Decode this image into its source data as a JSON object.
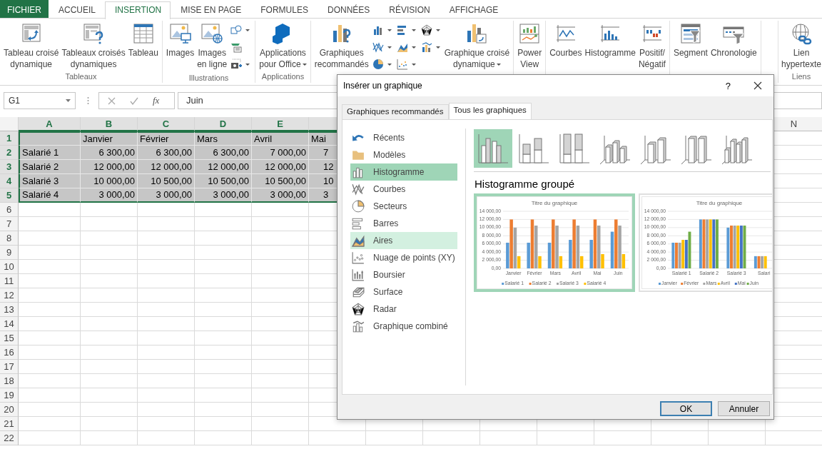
{
  "ribbon": {
    "tabs": [
      {
        "label": "FICHIER",
        "kind": "file",
        "selected": false
      },
      {
        "label": "ACCUEIL",
        "kind": "tab",
        "selected": false
      },
      {
        "label": "INSERTION",
        "kind": "tab",
        "selected": true
      },
      {
        "label": "MISE EN PAGE",
        "kind": "tab",
        "selected": false
      },
      {
        "label": "FORMULES",
        "kind": "tab",
        "selected": false
      },
      {
        "label": "DONNÉES",
        "kind": "tab",
        "selected": false
      },
      {
        "label": "RÉVISION",
        "kind": "tab",
        "selected": false
      },
      {
        "label": "AFFICHAGE",
        "kind": "tab",
        "selected": false
      }
    ],
    "groups": [
      {
        "label": "Tableaux",
        "items": [
          {
            "kind": "pivot-table",
            "label": "Tableau croisé\ndynamique"
          },
          {
            "kind": "recommended-pivot",
            "label": "Tableaux croisés\ndynamiques"
          },
          {
            "kind": "table",
            "label": "Tableau"
          }
        ]
      },
      {
        "label": "Illustrations",
        "items": [
          {
            "kind": "images",
            "label": "Images"
          },
          {
            "kind": "online-images",
            "label": "Images\nen ligne"
          },
          {
            "kind": "stack",
            "buttons": [
              {
                "kind": "shapes",
                "has_menu": true
              },
              {
                "kind": "smartart",
                "has_menu": false
              },
              {
                "kind": "screenshot",
                "has_menu": true
              }
            ]
          }
        ]
      },
      {
        "label": "Applications",
        "items": [
          {
            "kind": "apps",
            "label": "Applications\npour Office",
            "has_menu": true
          }
        ]
      },
      {
        "items": [
          {
            "kind": "recommended-charts",
            "label": "Graphiques\nrecommandés"
          },
          {
            "kind": "stack",
            "buttons": [
              {
                "kind": "column",
                "has_menu": true
              },
              {
                "kind": "line",
                "has_menu": true
              },
              {
                "kind": "pie",
                "has_menu": true
              },
              {
                "kind": "bar",
                "has_menu": true
              },
              {
                "kind": "area",
                "has_menu": true
              },
              {
                "kind": "scatter",
                "has_menu": true
              },
              {
                "kind": "radar",
                "has_menu": true
              },
              {
                "kind": "combo",
                "has_menu": true
              }
            ]
          },
          {
            "kind": "pivot-chart",
            "label": "Graphique croisé\ndynamique",
            "has_menu": true
          }
        ]
      },
      {
        "items": [
          {
            "kind": "power-view",
            "label": "Power\nView"
          }
        ]
      },
      {
        "items": [
          {
            "kind": "line-spark",
            "label": "Courbes"
          },
          {
            "kind": "column-spark",
            "label": "Histogramme"
          },
          {
            "kind": "winloss",
            "label": "Positif/\nNégatif"
          }
        ]
      },
      {
        "items": [
          {
            "kind": "slicer",
            "label": "Segment"
          },
          {
            "kind": "timeline",
            "label": "Chronologie"
          }
        ]
      },
      {
        "label": "Liens",
        "items": [
          {
            "kind": "link",
            "label": "Lien\nhypertexte"
          }
        ]
      }
    ]
  },
  "formula_bar": {
    "name_box": "G1",
    "function_label": "fx",
    "formula": "Juin"
  },
  "sheet": {
    "columns": [
      {
        "label": "A",
        "selected": true
      },
      {
        "label": "B",
        "selected": true
      },
      {
        "label": "C",
        "selected": true
      },
      {
        "label": "D",
        "selected": true
      },
      {
        "label": "E",
        "selected": true
      },
      {
        "label": "N",
        "selected": false
      }
    ],
    "rows": [
      {
        "number": "1",
        "kind": "header",
        "selected": true,
        "values": [
          "Janvier",
          "Février",
          "Mars",
          "Avril",
          "Mai"
        ]
      },
      {
        "number": "2",
        "kind": "data",
        "selected": true,
        "name": "Salarié 1",
        "values": [
          "6 300,00",
          "6 300,00",
          "6 300,00",
          "7 000,00",
          "7"
        ]
      },
      {
        "number": "3",
        "kind": "data",
        "selected": true,
        "name": "Salarié 2",
        "values": [
          "12 000,00",
          "12 000,00",
          "12 000,00",
          "12 000,00",
          "12"
        ]
      },
      {
        "number": "4",
        "kind": "data",
        "selected": true,
        "name": "Salarié 3",
        "values": [
          "10 000,00",
          "10 500,00",
          "10 500,00",
          "10 500,00",
          "10"
        ]
      },
      {
        "number": "5",
        "kind": "data",
        "selected": true,
        "name": "Salarié 4",
        "values": [
          "3 000,00",
          "3 000,00",
          "3 000,00",
          "3 000,00",
          "3"
        ]
      },
      {
        "number": "6",
        "kind": "empty",
        "selected": false
      },
      {
        "number": "7",
        "kind": "empty",
        "selected": false
      },
      {
        "number": "8",
        "kind": "empty",
        "selected": false
      },
      {
        "number": "9",
        "kind": "empty",
        "selected": false
      },
      {
        "number": "10",
        "kind": "empty",
        "selected": false
      },
      {
        "number": "11",
        "kind": "empty",
        "selected": false
      },
      {
        "number": "12",
        "kind": "empty",
        "selected": false
      },
      {
        "number": "13",
        "kind": "empty",
        "selected": false
      },
      {
        "number": "14",
        "kind": "empty",
        "selected": false
      },
      {
        "number": "15",
        "kind": "empty",
        "selected": false
      },
      {
        "number": "16",
        "kind": "empty",
        "selected": false
      },
      {
        "number": "17",
        "kind": "empty",
        "selected": false
      },
      {
        "number": "18",
        "kind": "empty",
        "selected": false
      },
      {
        "number": "19",
        "kind": "empty",
        "selected": false
      },
      {
        "number": "20",
        "kind": "empty",
        "selected": false
      },
      {
        "number": "21",
        "kind": "empty",
        "selected": false
      },
      {
        "number": "22",
        "kind": "empty",
        "selected": false
      }
    ]
  },
  "dialog": {
    "title": "Insérer un graphique",
    "help": "?",
    "tabs": [
      {
        "label": "Graphiques recommandés",
        "selected": false
      },
      {
        "label": "Tous les graphiques",
        "selected": true
      }
    ],
    "chart_types": [
      {
        "kind": "recent",
        "label": "Récents",
        "selected": false,
        "hovered": false
      },
      {
        "kind": "templates",
        "label": "Modèles",
        "selected": false,
        "hovered": false
      },
      {
        "kind": "column",
        "label": "Histogramme",
        "selected": true,
        "hovered": false
      },
      {
        "kind": "line",
        "label": "Courbes",
        "selected": false,
        "hovered": false
      },
      {
        "kind": "pie",
        "label": "Secteurs",
        "selected": false,
        "hovered": false
      },
      {
        "kind": "bar",
        "label": "Barres",
        "selected": false,
        "hovered": false
      },
      {
        "kind": "area",
        "label": "Aires",
        "selected": false,
        "hovered": true
      },
      {
        "kind": "scatter",
        "label": "Nuage de points (XY)",
        "selected": false,
        "hovered": false
      },
      {
        "kind": "stock",
        "label": "Boursier",
        "selected": false,
        "hovered": false
      },
      {
        "kind": "surface",
        "label": "Surface",
        "selected": false,
        "hovered": false
      },
      {
        "kind": "radar",
        "label": "Radar",
        "selected": false,
        "hovered": false
      },
      {
        "kind": "combo",
        "label": "Graphique combiné",
        "selected": false,
        "hovered": false
      }
    ],
    "subtypes": [
      {
        "kind": "clustered",
        "selected": true
      },
      {
        "kind": "stacked",
        "selected": false
      },
      {
        "kind": "stacked100",
        "selected": false
      },
      {
        "kind": "clustered3d",
        "selected": false
      },
      {
        "kind": "stacked3d",
        "selected": false
      },
      {
        "kind": "stacked100three",
        "selected": false
      },
      {
        "kind": "threed",
        "selected": false
      }
    ],
    "subtype_title": "Histogramme groupé",
    "previews": [
      {
        "selected": true,
        "chart_data": {
          "type": "bar",
          "title": "Titre du graphique",
          "grid": true,
          "legend": "bottom",
          "categories": [
            "Janvier",
            "Février",
            "Mars",
            "Avril",
            "Mai",
            "Juin"
          ],
          "series": [
            {
              "name": "Salarié 1",
              "color": "#5b9bd5",
              "values": [
                6300,
                6300,
                6300,
                7000,
                7000,
                9000
              ]
            },
            {
              "name": "Salarié 2",
              "color": "#ed7d31",
              "values": [
                12000,
                12000,
                12000,
                12000,
                12000,
                12000
              ]
            },
            {
              "name": "Salarié 3",
              "color": "#a5a5a5",
              "values": [
                10000,
                10500,
                10500,
                10500,
                10500,
                10500
              ]
            },
            {
              "name": "Salarié 4",
              "color": "#ffc000",
              "values": [
                3000,
                3000,
                3000,
                3000,
                3500,
                3500
              ]
            }
          ],
          "ylim": [
            0,
            14000
          ],
          "yticks": [
            {
              "value": 0,
              "label": "0,00"
            },
            {
              "value": 2000,
              "label": "2 000,00"
            },
            {
              "value": 4000,
              "label": "4 000,00"
            },
            {
              "value": 6000,
              "label": "6 000,00"
            },
            {
              "value": 8000,
              "label": "8 000,00"
            },
            {
              "value": 10000,
              "label": "10 000,00"
            },
            {
              "value": 12000,
              "label": "12 000,00"
            },
            {
              "value": 14000,
              "label": "14 000,00"
            }
          ]
        }
      },
      {
        "selected": false,
        "chart_data": {
          "type": "bar",
          "title": "Titre du graphique",
          "grid": true,
          "legend": "bottom",
          "categories": [
            "Salarié 1",
            "Salarié 2",
            "Salarié 3",
            "Salari"
          ],
          "series": [
            {
              "name": "Janvier",
              "color": "#5b9bd5",
              "values": [
                6300,
                12000,
                10000,
                3000
              ]
            },
            {
              "name": "Février",
              "color": "#ed7d31",
              "values": [
                6300,
                12000,
                10500,
                3000
              ]
            },
            {
              "name": "Mars",
              "color": "#a5a5a5",
              "values": [
                6300,
                12000,
                10500,
                3000
              ]
            },
            {
              "name": "Avril",
              "color": "#ffc000",
              "values": [
                7000,
                12000,
                10500,
                3000
              ]
            },
            {
              "name": "Mai",
              "color": "#4472c4",
              "values": [
                7000,
                12000,
                10500,
                null
              ]
            },
            {
              "name": "Juin",
              "color": "#70ad47",
              "values": [
                9000,
                12000,
                10500,
                null
              ]
            }
          ],
          "ylim": [
            0,
            14000
          ],
          "yticks": [
            {
              "value": 0,
              "label": "0,00"
            },
            {
              "value": 2000,
              "label": "2 000,00"
            },
            {
              "value": 4000,
              "label": "4 000,00"
            },
            {
              "value": 6000,
              "label": "6 000,00"
            },
            {
              "value": 8000,
              "label": "8 000,00"
            },
            {
              "value": 10000,
              "label": "10 000,00"
            },
            {
              "value": 12000,
              "label": "12 000,00"
            },
            {
              "value": 14000,
              "label": "14 000,00"
            }
          ]
        }
      }
    ],
    "buttons": [
      {
        "label": "OK",
        "kind": "default"
      },
      {
        "label": "Annuler",
        "kind": "normal"
      }
    ]
  }
}
